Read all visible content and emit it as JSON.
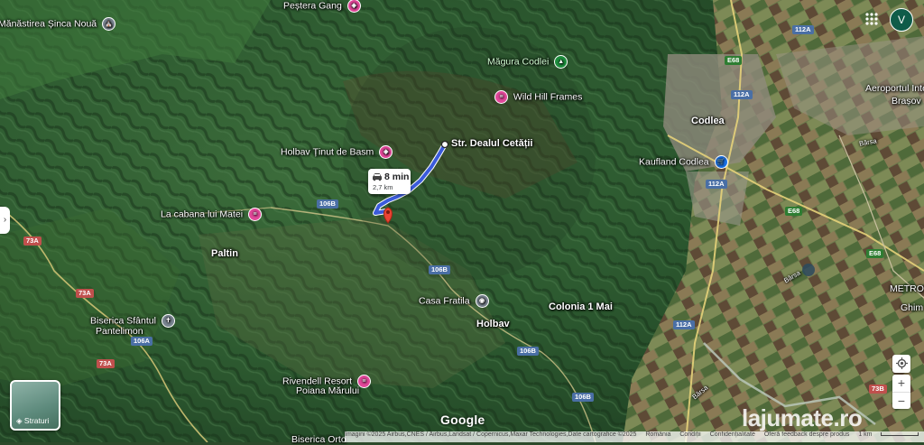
{
  "map": {
    "places": [
      {
        "id": "pestera-gang",
        "label": "Peștera Gang",
        "pin": "pin-pink",
        "pin_glyph": "◈"
      },
      {
        "id": "manastirea",
        "label": "Mănăstirea Șinca Nouă",
        "pin": "pin-gray",
        "pin_glyph": "⛪"
      },
      {
        "id": "magura-codlei",
        "label": "Măgura Codlei",
        "pin": "pin-green",
        "pin_glyph": "▲"
      },
      {
        "id": "wild-hill",
        "label": "Wild Hill Frames",
        "pin": "pin-pink",
        "pin_glyph": "≡"
      },
      {
        "id": "holbav-tinut",
        "label": "Holbav Ținut de Basm",
        "pin": "pin-pink",
        "pin_glyph": "◈"
      },
      {
        "id": "str-dealul",
        "label": "Str. Dealul Cetății",
        "pin": "",
        "pin_glyph": ""
      },
      {
        "id": "la-cabana",
        "label": "La cabana lui Matei",
        "pin": "pin-pink",
        "pin_glyph": "≡"
      },
      {
        "id": "paltin",
        "label": "Paltin",
        "pin": "",
        "pin_glyph": ""
      },
      {
        "id": "codlea",
        "label": "Codlea",
        "pin": "",
        "pin_glyph": ""
      },
      {
        "id": "kaufland",
        "label": "Kaufland Codlea",
        "pin": "pin-blue",
        "pin_glyph": "🛒"
      },
      {
        "id": "aeroport",
        "label": "Aeroportul Inte",
        "pin": "",
        "pin_glyph": ""
      },
      {
        "id": "brasov",
        "label": "Brașov",
        "pin": "",
        "pin_glyph": ""
      },
      {
        "id": "casa-fratila",
        "label": "Casa Fratila",
        "pin": "pin-gray",
        "pin_glyph": "◉"
      },
      {
        "id": "holbav",
        "label": "Holbav",
        "pin": "",
        "pin_glyph": ""
      },
      {
        "id": "colonia",
        "label": "Colonia 1 Mai",
        "pin": "",
        "pin_glyph": ""
      },
      {
        "id": "biserica-pantelimon-1",
        "label": "Biserica Sfântul",
        "pin": "pin-gray",
        "pin_glyph": "✝"
      },
      {
        "id": "biserica-pantelimon-2",
        "label": "Pantelimon",
        "pin": "",
        "pin_glyph": ""
      },
      {
        "id": "rivendell-1",
        "label": "Rivendell Resort",
        "pin": "pin-pink",
        "pin_glyph": "≡"
      },
      {
        "id": "rivendell-2",
        "label": "Poiana Mărului",
        "pin": "",
        "pin_glyph": ""
      },
      {
        "id": "biserica-orto",
        "label": "Biserica Orto",
        "pin": "",
        "pin_glyph": ""
      },
      {
        "id": "metro",
        "label": "METRO",
        "pin": "",
        "pin_glyph": ""
      },
      {
        "id": "ghim",
        "label": "Ghim",
        "pin": "",
        "pin_glyph": ""
      },
      {
        "id": "barsa-1",
        "label": "Bârsa",
        "pin": "",
        "pin_glyph": ""
      },
      {
        "id": "barsa-2",
        "label": "Bârsa",
        "pin": "",
        "pin_glyph": ""
      },
      {
        "id": "barsa-3",
        "label": "Bârsa",
        "pin": "",
        "pin_glyph": ""
      }
    ],
    "roads": [
      {
        "id": "r112a-1",
        "label": "112A"
      },
      {
        "id": "r112a-2",
        "label": "112A"
      },
      {
        "id": "r112a-3",
        "label": "112A"
      },
      {
        "id": "r112a-4",
        "label": "112A"
      },
      {
        "id": "re68-1",
        "label": "E68"
      },
      {
        "id": "re68-2",
        "label": "E68"
      },
      {
        "id": "re68-3",
        "label": "E68"
      },
      {
        "id": "r106b-1",
        "label": "106B"
      },
      {
        "id": "r106b-2",
        "label": "106B"
      },
      {
        "id": "r106b-3",
        "label": "106B"
      },
      {
        "id": "r106b-4",
        "label": "106B"
      },
      {
        "id": "r73a-1",
        "label": "73A"
      },
      {
        "id": "r73a-2",
        "label": "73A"
      },
      {
        "id": "r73a-3",
        "label": "73A"
      },
      {
        "id": "r106a",
        "label": "106A"
      },
      {
        "id": "r73b",
        "label": "73B"
      }
    ],
    "route": {
      "time": "8 min",
      "distance": "2,7 km"
    }
  },
  "controls": {
    "avatar_initial": "V",
    "layers_label": "Straturi",
    "zoom_in": "+",
    "zoom_out": "−"
  },
  "footer": {
    "attribution": "Imagini ©2025 Airbus,CNES / Airbus,Landsat / Copernicus,Maxar Technologies,Date cartografice ©2025",
    "country": "România",
    "terms": "Condiții",
    "privacy": "Confidențialitate",
    "feedback": "Oferă feedback despre produs",
    "scale": "1 km"
  },
  "branding": {
    "google": "Google",
    "watermark": "lajumate.ro"
  },
  "colors": {
    "route": "#3b5bdb",
    "pin_pink": "#e2489a",
    "pin_green": "#1e8e3e",
    "pin_blue": "#1a73e8"
  }
}
